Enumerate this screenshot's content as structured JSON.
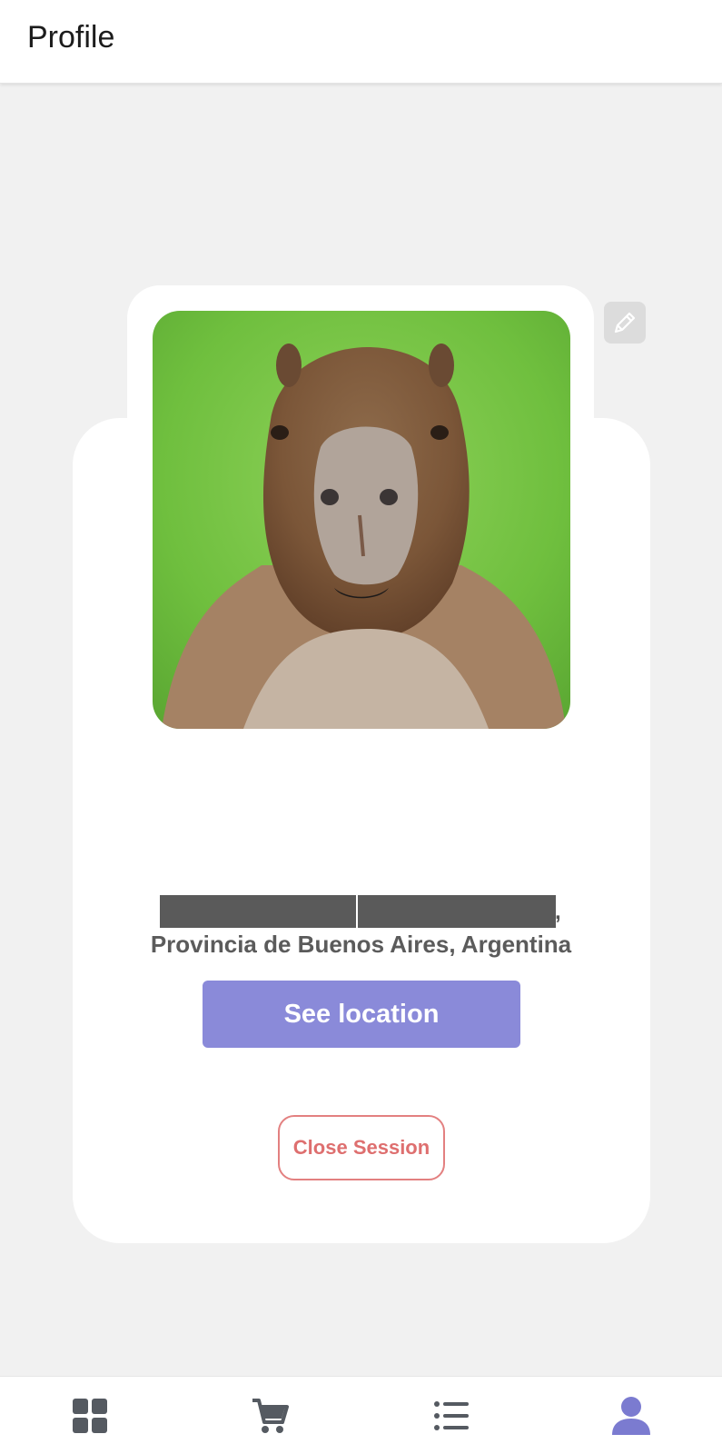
{
  "header": {
    "title": "Profile"
  },
  "profile": {
    "photo_alt": "capybara",
    "location_suffix": ",",
    "location": "Provincia de Buenos Aires, Argentina",
    "see_location_label": "See location",
    "close_session_label": "Close Session"
  },
  "nav": {
    "items": [
      {
        "icon": "dashboard-icon"
      },
      {
        "icon": "cart-icon"
      },
      {
        "icon": "list-icon"
      },
      {
        "icon": "user-icon",
        "active": true
      }
    ],
    "inactive_color": "#555a61",
    "active_color": "#7b7bd0"
  },
  "colors": {
    "accent": "#8a8ad9",
    "danger": "#de6f6f",
    "background": "#f1f1f1"
  }
}
